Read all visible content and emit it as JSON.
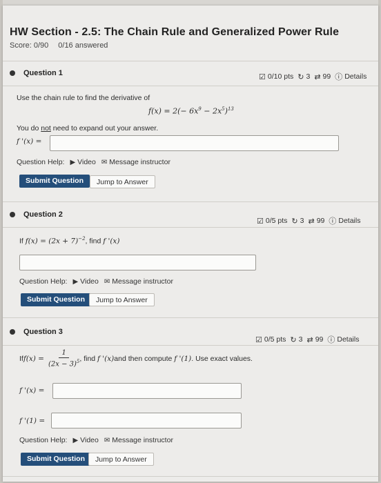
{
  "assignment": {
    "title": "HW Section - 2.5: The Chain Rule and Generalized Power Rule",
    "score": "Score: 0/90",
    "answered": "0/16 answered"
  },
  "questions": [
    {
      "label": "Question 1",
      "points": "0/10 pts",
      "attempts": "3",
      "tries": "99",
      "details": "Details",
      "prompt": "Use the chain rule to find the derivative of",
      "formula_lhs": "f(x) = 2(− 6x",
      "formula_exp1": "9",
      "formula_mid": " − 2x",
      "formula_exp2": "5",
      "formula_rhs": ")",
      "formula_exp3": "13",
      "note_pre": "You do ",
      "note_not": "not",
      "note_post": " need to expand out your answer.",
      "answer_label": "f '(x) ="
    },
    {
      "label": "Question 2",
      "points": "0/5 pts",
      "attempts": "3",
      "tries": "99",
      "details": "Details",
      "prompt_pre": "If ",
      "prompt_math": "f(x) = (2x + 7)",
      "prompt_exp": "−2",
      "prompt_post": ", find ",
      "prompt_math2": "f '(x)"
    },
    {
      "label": "Question 3",
      "points": "0/5 pts",
      "attempts": "3",
      "tries": "99",
      "details": "Details",
      "prompt_pre": "If ",
      "prompt_math": "f(x) =",
      "frac_num": "1",
      "frac_den": "(2x − 3)",
      "frac_den_exp": "5",
      "prompt_post1": ", find ",
      "prompt_math2": "f '(x)",
      "prompt_post2": " and then compute ",
      "prompt_math3": "f '(1)",
      "prompt_post3": ". Use exact values.",
      "answer_label1": "f '(x) =",
      "answer_label2": "f '(1) ="
    }
  ],
  "help": {
    "label": "Question Help:",
    "video": "Video",
    "message": "Message instructor"
  },
  "buttons": {
    "submit": "Submit Question",
    "jump": "Jump to Answer"
  },
  "colors": {
    "submit_bg": "#244e7a",
    "page_bg": "#edecea"
  }
}
